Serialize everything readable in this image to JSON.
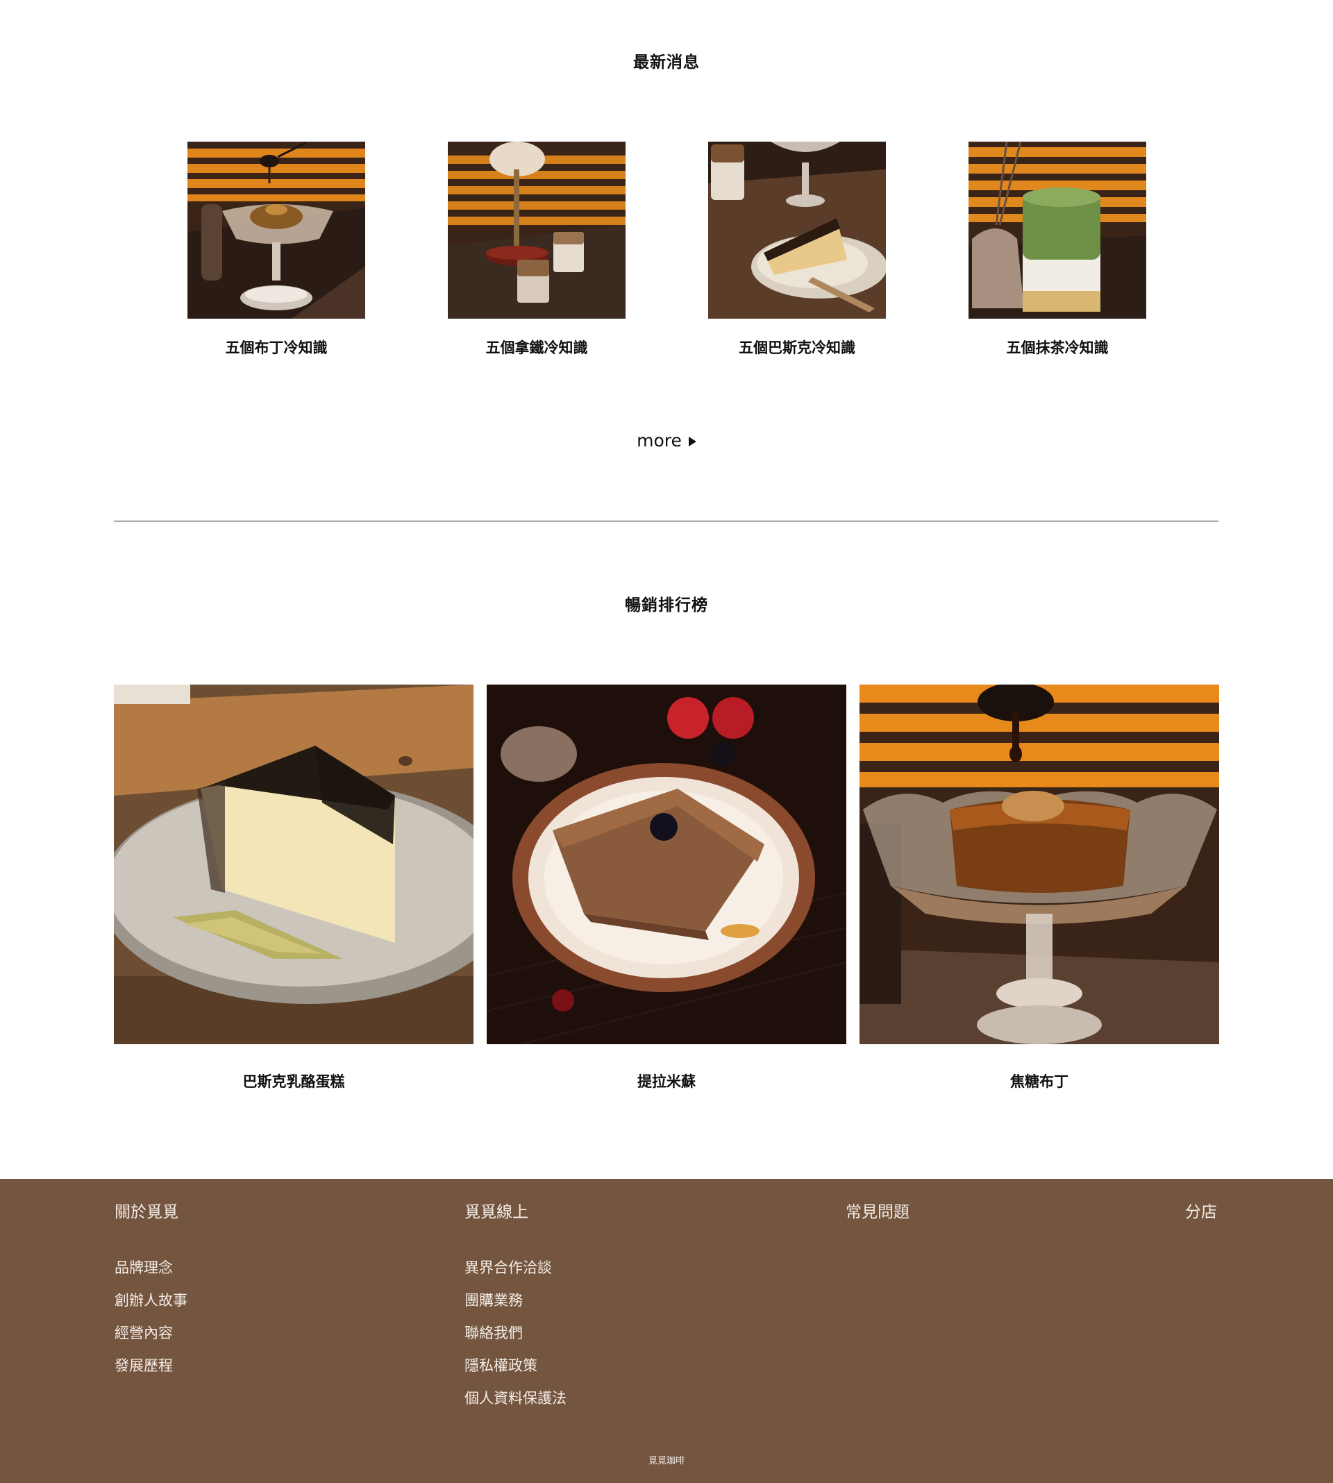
{
  "news": {
    "title": "最新消息",
    "items": [
      {
        "label": "五個布丁冷知識"
      },
      {
        "label": "五個拿鐵冷知識"
      },
      {
        "label": "五個巴斯克冷知識"
      },
      {
        "label": "五個抹茶冷知識"
      }
    ],
    "more_label": "more"
  },
  "bestsellers": {
    "title": "暢銷排行榜",
    "items": [
      {
        "label": "巴斯克乳酪蛋糕"
      },
      {
        "label": "提拉米蘇"
      },
      {
        "label": "焦糖布丁"
      }
    ]
  },
  "footer": {
    "columns": [
      {
        "heading": "關於覓覓",
        "links": [
          "品牌理念",
          "創辦人故事",
          "經營內容",
          "發展歷程"
        ]
      },
      {
        "heading": "覓覓線上",
        "links": [
          "異界合作洽談",
          "團購業務",
          "聯絡我們",
          "隱私權政策",
          "個人資料保護法"
        ]
      },
      {
        "heading": "常見問題",
        "links": []
      },
      {
        "heading": "分店",
        "links": []
      }
    ],
    "copyright": "覓覓珈啡"
  },
  "colors": {
    "footer_bg": "#74553f",
    "footer_text": "#f4ede6",
    "text": "#111111"
  }
}
